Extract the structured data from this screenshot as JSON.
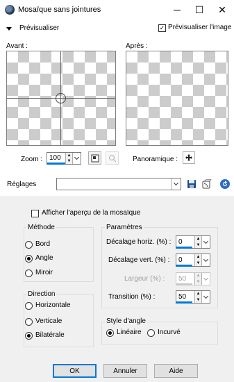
{
  "window": {
    "title": "Mosaïque sans jointures",
    "minimize": "─",
    "maximize": "☐",
    "close": "✕"
  },
  "preview_bar": {
    "previsualiser_label": "Prévisualiser",
    "preview_image_label": "Prévisualiser l'image",
    "preview_image_checked": true
  },
  "panes": {
    "before_label": "Avant :",
    "after_label": "Après :"
  },
  "zoom": {
    "label": "Zoom :",
    "value": "100",
    "panoramique_label": "Panoramique :"
  },
  "reglages": {
    "label": "Réglages",
    "value": ""
  },
  "main": {
    "show_mosaic_label": "Afficher l'aperçu de la mosaïque",
    "show_mosaic_checked": false,
    "methode": {
      "legend": "Méthode",
      "options": [
        {
          "label": "Bord",
          "selected": false
        },
        {
          "label": "Angle",
          "selected": true
        },
        {
          "label": "Miroir",
          "selected": false
        }
      ]
    },
    "direction": {
      "legend": "Direction",
      "options": [
        {
          "label": "Horizontale",
          "selected": false
        },
        {
          "label": "Verticale",
          "selected": false
        },
        {
          "label": "Bilatérale",
          "selected": true
        }
      ]
    },
    "parametres": {
      "legend": "Paramètres",
      "fields": [
        {
          "label": "Décalage horiz. (%) :",
          "value": "0",
          "enabled": true
        },
        {
          "label": "Décalage vert. (%) :",
          "value": "0",
          "enabled": true
        },
        {
          "label": "Largeur (%) :",
          "value": "50",
          "enabled": false
        },
        {
          "label": "Transition (%) :",
          "value": "50",
          "enabled": true
        }
      ]
    },
    "style_angle": {
      "legend": "Style d'angle",
      "options": [
        {
          "label": "Linéaire",
          "selected": true
        },
        {
          "label": "Incurvé",
          "selected": false
        }
      ]
    }
  },
  "buttons": {
    "ok": "OK",
    "cancel": "Annuler",
    "help": "Aide"
  },
  "colors": {
    "panel_bg": "#f0f0f0",
    "accent": "#0078d7",
    "checker": "#cccccc"
  }
}
